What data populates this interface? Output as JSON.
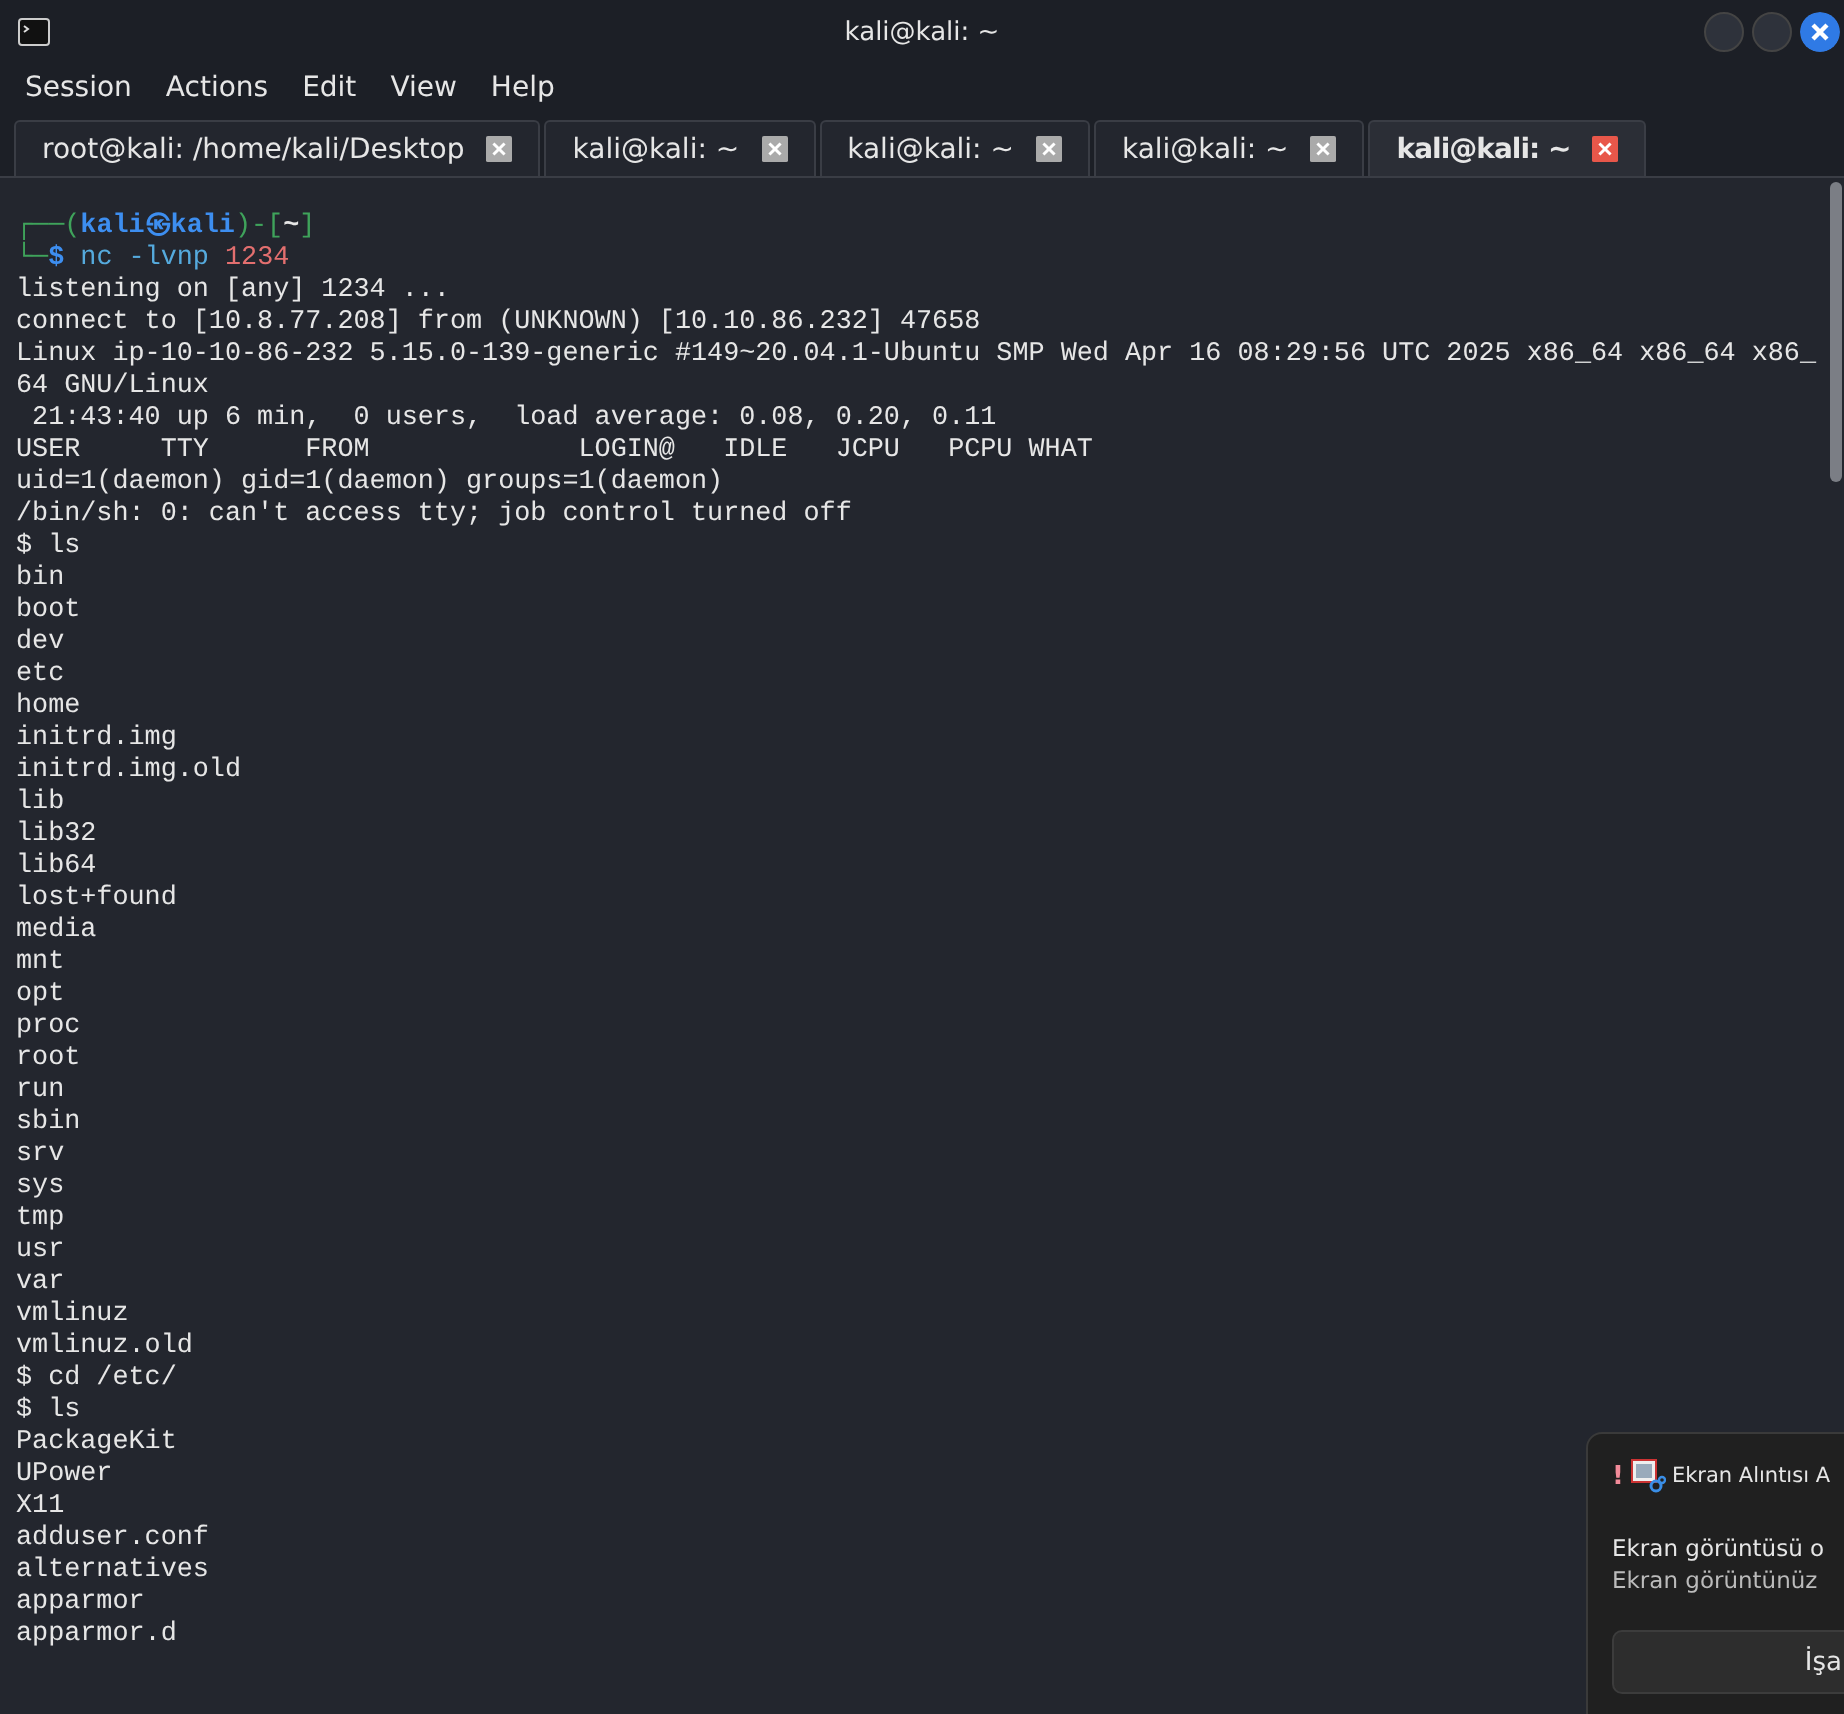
{
  "window": {
    "title": "kali@kali: ~"
  },
  "menu": [
    "Session",
    "Actions",
    "Edit",
    "View",
    "Help"
  ],
  "tabs": [
    {
      "label": "root@kali: /home/kali/Desktop",
      "selected": false
    },
    {
      "label": "kali@kali: ~",
      "selected": false
    },
    {
      "label": "kali@kali: ~",
      "selected": false
    },
    {
      "label": "kali@kali: ~",
      "selected": false
    },
    {
      "label": "kali@kali: ~",
      "selected": true
    }
  ],
  "terminal": [
    {
      "kind": "prompt",
      "top_left": "┌──(",
      "user": "kali",
      "at": "㉿",
      "host": "kali",
      "mid": ")-[",
      "dir": "~",
      "close": "]",
      "bottom_left": "└─",
      "symbol": "$",
      "command": "nc -lvnp",
      "arg": "1234"
    },
    {
      "kind": "text",
      "text": "listening on [any] 1234 ..."
    },
    {
      "kind": "text",
      "text": "connect to [10.8.77.208] from (UNKNOWN) [10.10.86.232] 47658"
    },
    {
      "kind": "text",
      "text": "Linux ip-10-10-86-232 5.15.0-139-generic #149~20.04.1-Ubuntu SMP Wed Apr 16 08:29:56 UTC 2025 x86_64 x86_64 x86_"
    },
    {
      "kind": "text",
      "text": "64 GNU/Linux"
    },
    {
      "kind": "text",
      "text": " 21:43:40 up 6 min,  0 users,  load average: 0.08, 0.20, 0.11"
    },
    {
      "kind": "text",
      "text": "USER     TTY      FROM             LOGIN@   IDLE   JCPU   PCPU WHAT"
    },
    {
      "kind": "text",
      "text": "uid=1(daemon) gid=1(daemon) groups=1(daemon)"
    },
    {
      "kind": "text",
      "text": "/bin/sh: 0: can't access tty; job control turned off"
    },
    {
      "kind": "text",
      "text": "$ ls"
    },
    {
      "kind": "text",
      "text": "bin"
    },
    {
      "kind": "text",
      "text": "boot"
    },
    {
      "kind": "text",
      "text": "dev"
    },
    {
      "kind": "text",
      "text": "etc"
    },
    {
      "kind": "text",
      "text": "home"
    },
    {
      "kind": "text",
      "text": "initrd.img"
    },
    {
      "kind": "text",
      "text": "initrd.img.old"
    },
    {
      "kind": "text",
      "text": "lib"
    },
    {
      "kind": "text",
      "text": "lib32"
    },
    {
      "kind": "text",
      "text": "lib64"
    },
    {
      "kind": "text",
      "text": "lost+found"
    },
    {
      "kind": "text",
      "text": "media"
    },
    {
      "kind": "text",
      "text": "mnt"
    },
    {
      "kind": "text",
      "text": "opt"
    },
    {
      "kind": "text",
      "text": "proc"
    },
    {
      "kind": "text",
      "text": "root"
    },
    {
      "kind": "text",
      "text": "run"
    },
    {
      "kind": "text",
      "text": "sbin"
    },
    {
      "kind": "text",
      "text": "srv"
    },
    {
      "kind": "text",
      "text": "sys"
    },
    {
      "kind": "text",
      "text": "tmp"
    },
    {
      "kind": "text",
      "text": "usr"
    },
    {
      "kind": "text",
      "text": "var"
    },
    {
      "kind": "text",
      "text": "vmlinuz"
    },
    {
      "kind": "text",
      "text": "vmlinuz.old"
    },
    {
      "kind": "text",
      "text": "$ cd /etc/"
    },
    {
      "kind": "text",
      "text": "$ ls"
    },
    {
      "kind": "text",
      "text": "PackageKit"
    },
    {
      "kind": "text",
      "text": "UPower"
    },
    {
      "kind": "text",
      "text": "X11"
    },
    {
      "kind": "text",
      "text": "adduser.conf"
    },
    {
      "kind": "text",
      "text": "alternatives"
    },
    {
      "kind": "text",
      "text": "apparmor"
    },
    {
      "kind": "text",
      "text": "apparmor.d"
    }
  ],
  "notification": {
    "alert": "!",
    "app": "Ekran Alıntısı A",
    "title": "Ekran görüntüsü o",
    "body": "Ekran görüntünüz",
    "button": "İşa"
  }
}
